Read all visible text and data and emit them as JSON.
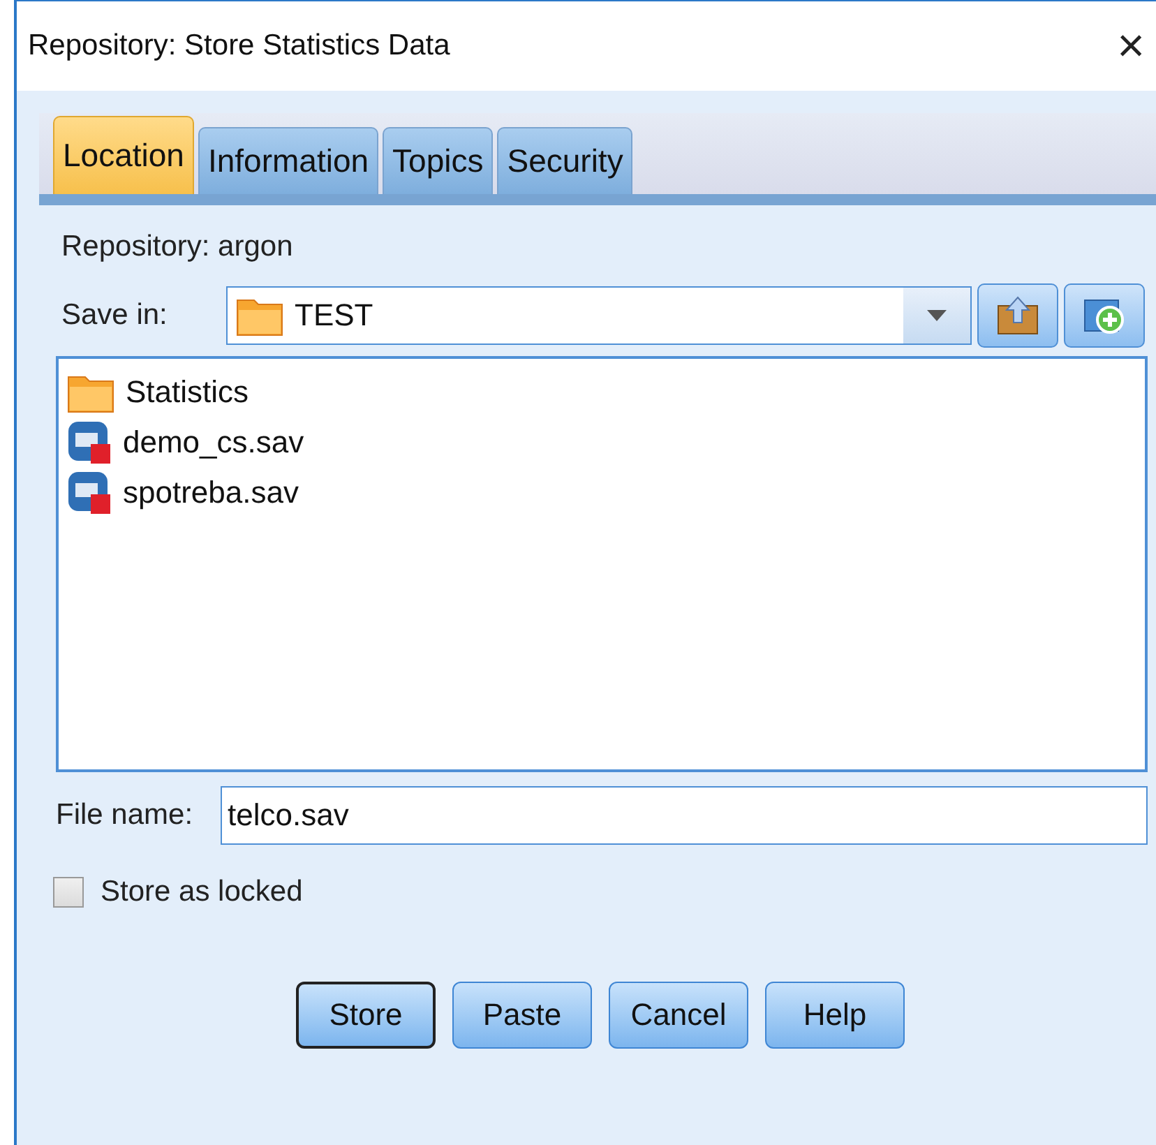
{
  "window": {
    "title": "Repository: Store Statistics Data",
    "close": "×"
  },
  "tabs": [
    {
      "label": "Location",
      "selected": true
    },
    {
      "label": "Information",
      "selected": false
    },
    {
      "label": "Topics",
      "selected": false
    },
    {
      "label": "Security",
      "selected": false
    }
  ],
  "repository_label": "Repository: argon",
  "save_in": {
    "label": "Save in:",
    "value": "TEST"
  },
  "files": [
    {
      "kind": "folder",
      "name": "Statistics"
    },
    {
      "kind": "data",
      "name": "demo_cs.sav"
    },
    {
      "kind": "data",
      "name": "spotreba.sav"
    }
  ],
  "file_name": {
    "label": "File name:",
    "value": "telco.sav"
  },
  "store_as_locked": {
    "label": "Store as locked",
    "checked": false
  },
  "buttons": [
    {
      "label": "Store",
      "default": true
    },
    {
      "label": "Paste",
      "default": false
    },
    {
      "label": "Cancel",
      "default": false
    },
    {
      "label": "Help",
      "default": false
    }
  ]
}
